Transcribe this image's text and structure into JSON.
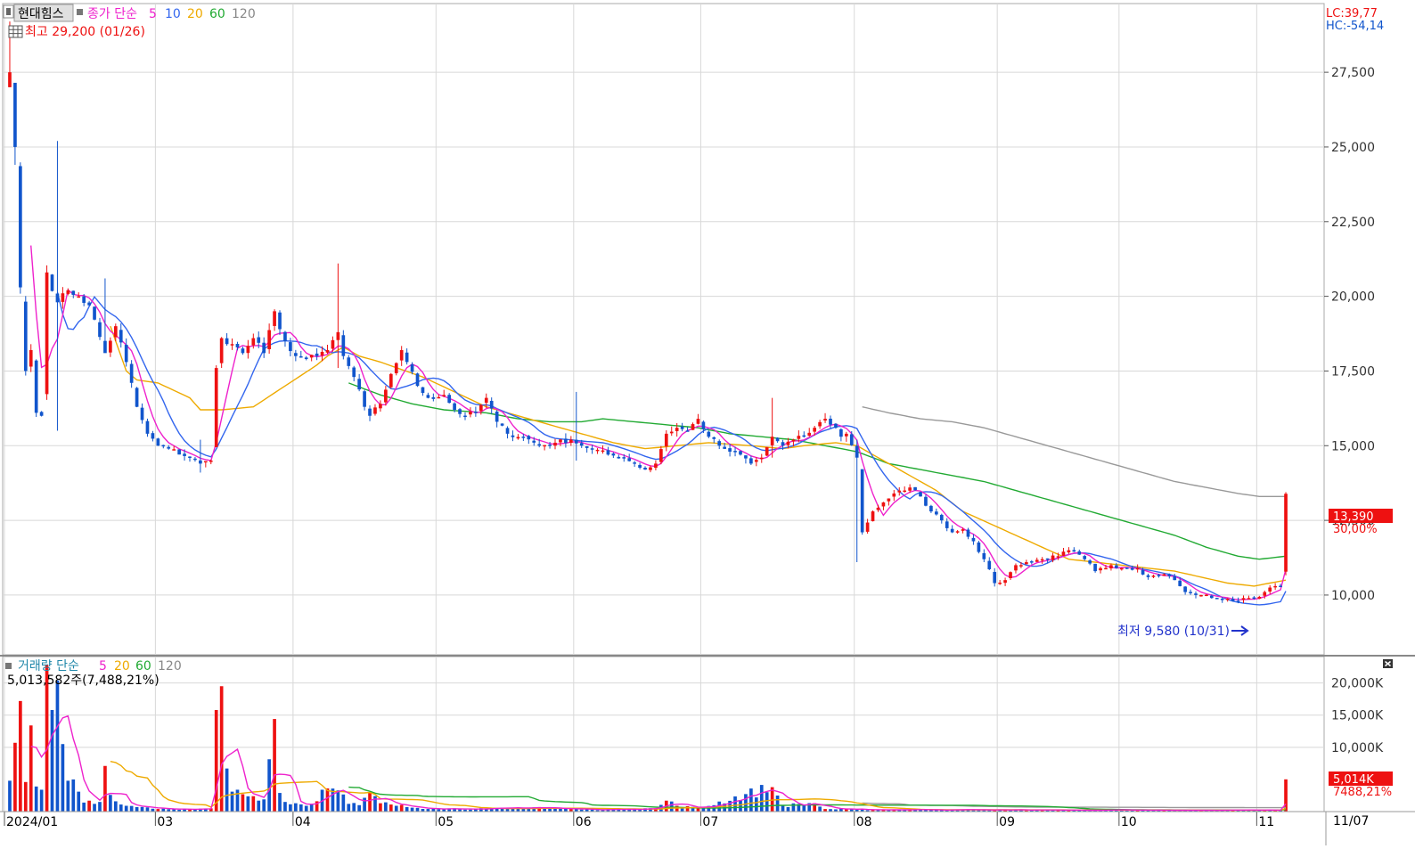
{
  "legend_price": {
    "symbol": "현대힘스",
    "ma_label": "종가 단순",
    "ma_periods": [
      "5",
      "10",
      "20",
      "60",
      "120"
    ],
    "high_label": "최고 29,200 (01/26)",
    "low_label": "최저 9,580 (10/31)"
  },
  "legend_volume": {
    "label": "거래량 단순",
    "ma_periods": [
      "5",
      "20",
      "60",
      "120"
    ],
    "current": "5,013,582주(7,488,21%)"
  },
  "indicators": {
    "lc": "LC:39,77",
    "hc": "HC:-54,14"
  },
  "price_tag": {
    "value": "13,390",
    "change": "30,00%"
  },
  "volume_tag": {
    "value": "5,014K",
    "change": "7488,21%"
  },
  "colors": {
    "up": "#ee1111",
    "down": "#1155cc",
    "ma5": "#ee22cc",
    "ma10": "#3366ee",
    "ma20": "#eeaa00",
    "ma60": "#22aa33",
    "ma120": "#999999",
    "grid": "#d8d8d8",
    "symbol_box": "#e0e0e0"
  },
  "chart_data": [
    {
      "type": "candlestick",
      "name": "price",
      "x_ticks": [
        {
          "i": 0,
          "label": "2024/01"
        },
        {
          "i": 28,
          "label": "03"
        },
        {
          "i": 54,
          "label": "04"
        },
        {
          "i": 81,
          "label": "05"
        },
        {
          "i": 107,
          "label": "06"
        },
        {
          "i": 131,
          "label": "07"
        },
        {
          "i": 160,
          "label": "08"
        },
        {
          "i": 187,
          "label": "09"
        },
        {
          "i": 210,
          "label": "10"
        },
        {
          "i": 236,
          "label": "11"
        }
      ],
      "x_end_label": "11/07",
      "n": 242,
      "ylim": [
        8000,
        29800
      ],
      "y_ticks": [
        10000,
        12500,
        15000,
        17500,
        20000,
        22500,
        25000,
        27500
      ],
      "y_tick_labels": [
        "10,000",
        "12,500",
        "15,000",
        "17,500",
        "20,000",
        "22,500",
        "25,000",
        "27,500"
      ],
      "keypoints": [
        [
          0,
          27500
        ],
        [
          1,
          25000
        ],
        [
          2,
          20300
        ],
        [
          3,
          17500
        ],
        [
          4,
          18200
        ],
        [
          5,
          16100
        ],
        [
          6,
          16000
        ],
        [
          7,
          20800
        ],
        [
          9,
          19800
        ],
        [
          11,
          20200
        ],
        [
          13,
          20000
        ],
        [
          15,
          19700
        ],
        [
          18,
          18100
        ],
        [
          20,
          19000
        ],
        [
          22,
          17800
        ],
        [
          24,
          16300
        ],
        [
          26,
          15400
        ],
        [
          28,
          15000
        ],
        [
          30,
          14900
        ],
        [
          34,
          14600
        ],
        [
          36,
          14400
        ],
        [
          38,
          14500
        ],
        [
          39,
          17600
        ],
        [
          40,
          18600
        ],
        [
          42,
          18400
        ],
        [
          44,
          18100
        ],
        [
          46,
          18600
        ],
        [
          48,
          18100
        ],
        [
          50,
          19500
        ],
        [
          51,
          18900
        ],
        [
          52,
          18500
        ],
        [
          54,
          18000
        ],
        [
          56,
          17900
        ],
        [
          58,
          18000
        ],
        [
          60,
          18200
        ],
        [
          62,
          18800
        ],
        [
          63,
          18000
        ],
        [
          65,
          17300
        ],
        [
          67,
          16300
        ],
        [
          68,
          16000
        ],
        [
          70,
          16400
        ],
        [
          72,
          17400
        ],
        [
          74,
          18200
        ],
        [
          75,
          17800
        ],
        [
          77,
          17000
        ],
        [
          79,
          16600
        ],
        [
          82,
          16700
        ],
        [
          84,
          16200
        ],
        [
          86,
          16000
        ],
        [
          88,
          16100
        ],
        [
          90,
          16600
        ],
        [
          92,
          15800
        ],
        [
          94,
          15400
        ],
        [
          97,
          15300
        ],
        [
          100,
          15000
        ],
        [
          103,
          15100
        ],
        [
          106,
          15200
        ],
        [
          108,
          15000
        ],
        [
          110,
          14900
        ],
        [
          113,
          14700
        ],
        [
          116,
          14600
        ],
        [
          118,
          14400
        ],
        [
          120,
          14200
        ],
        [
          122,
          14400
        ],
        [
          124,
          15400
        ],
        [
          126,
          15600
        ],
        [
          128,
          15500
        ],
        [
          130,
          15900
        ],
        [
          132,
          15300
        ],
        [
          134,
          15000
        ],
        [
          136,
          14800
        ],
        [
          138,
          14700
        ],
        [
          140,
          14400
        ],
        [
          142,
          14600
        ],
        [
          144,
          15300
        ],
        [
          146,
          15000
        ],
        [
          148,
          15200
        ],
        [
          150,
          15300
        ],
        [
          152,
          15600
        ],
        [
          154,
          15900
        ],
        [
          156,
          15600
        ],
        [
          157,
          15300
        ],
        [
          158,
          15400
        ],
        [
          160,
          14600
        ],
        [
          161,
          12100
        ],
        [
          163,
          12800
        ],
        [
          165,
          13100
        ],
        [
          167,
          13400
        ],
        [
          169,
          13500
        ],
        [
          170,
          13600
        ],
        [
          172,
          13300
        ],
        [
          174,
          12800
        ],
        [
          176,
          12500
        ],
        [
          178,
          12100
        ],
        [
          180,
          12200
        ],
        [
          182,
          11800
        ],
        [
          184,
          11200
        ],
        [
          186,
          10400
        ],
        [
          188,
          10500
        ],
        [
          190,
          11000
        ],
        [
          192,
          11100
        ],
        [
          195,
          11200
        ],
        [
          198,
          11300
        ],
        [
          200,
          11500
        ],
        [
          203,
          11200
        ],
        [
          205,
          10800
        ],
        [
          208,
          11000
        ],
        [
          211,
          10900
        ],
        [
          213,
          10900
        ],
        [
          215,
          10600
        ],
        [
          218,
          10700
        ],
        [
          220,
          10500
        ],
        [
          222,
          10100
        ],
        [
          225,
          10000
        ],
        [
          228,
          9900
        ],
        [
          231,
          9800
        ],
        [
          233,
          9900
        ],
        [
          235,
          9900
        ],
        [
          237,
          10100
        ],
        [
          239,
          10300
        ],
        [
          240,
          10300
        ],
        [
          241,
          13390
        ]
      ],
      "wicks": {
        "0": [
          27000,
          29200
        ],
        "1": [
          24400,
          25050
        ],
        "9": [
          15500,
          25200
        ],
        "18": [
          18400,
          20600
        ],
        "36": [
          14100,
          15200
        ],
        "62": [
          17600,
          21100
        ],
        "107": [
          14500,
          16800
        ],
        "144": [
          14600,
          16600
        ],
        "160": [
          11100,
          15200
        ]
      },
      "ma_offsets": {
        "ma10": [
          [
            0,
            0
          ],
          [
            20,
            0
          ],
          [
            50,
            -60
          ],
          [
            100,
            70
          ],
          [
            140,
            100
          ],
          [
            170,
            160
          ],
          [
            200,
            120
          ],
          [
            241,
            -250
          ]
        ]
      },
      "ma_start": {
        "ma5": 4,
        "ma10": 9,
        "ma20": 19,
        "ma60": 64,
        "ma120": 161
      },
      "ma20_keypoints": [
        [
          19,
          19000
        ],
        [
          22,
          17500
        ],
        [
          24,
          17200
        ],
        [
          28,
          17100
        ],
        [
          34,
          16600
        ],
        [
          36,
          16200
        ],
        [
          40,
          16200
        ],
        [
          46,
          16300
        ],
        [
          52,
          17000
        ],
        [
          58,
          17700
        ],
        [
          60,
          18000
        ],
        [
          63,
          18300
        ],
        [
          66,
          18000
        ],
        [
          70,
          17800
        ],
        [
          78,
          17300
        ],
        [
          84,
          16800
        ],
        [
          90,
          16300
        ],
        [
          96,
          16000
        ],
        [
          102,
          15700
        ],
        [
          108,
          15400
        ],
        [
          114,
          15100
        ],
        [
          120,
          14900
        ],
        [
          126,
          15000
        ],
        [
          132,
          15100
        ],
        [
          140,
          15000
        ],
        [
          146,
          14900
        ],
        [
          150,
          15000
        ],
        [
          156,
          15100
        ],
        [
          160,
          15000
        ],
        [
          165,
          14500
        ],
        [
          170,
          14000
        ],
        [
          175,
          13500
        ],
        [
          180,
          12800
        ],
        [
          185,
          12400
        ],
        [
          190,
          12000
        ],
        [
          195,
          11600
        ],
        [
          200,
          11200
        ],
        [
          205,
          11100
        ],
        [
          210,
          11000
        ],
        [
          215,
          10900
        ],
        [
          220,
          10800
        ],
        [
          225,
          10600
        ],
        [
          230,
          10400
        ],
        [
          235,
          10300
        ],
        [
          241,
          10500
        ]
      ],
      "ma60_keypoints": [
        [
          64,
          17100
        ],
        [
          70,
          16700
        ],
        [
          76,
          16400
        ],
        [
          82,
          16200
        ],
        [
          90,
          16100
        ],
        [
          96,
          15900
        ],
        [
          102,
          15800
        ],
        [
          108,
          15800
        ],
        [
          112,
          15900
        ],
        [
          118,
          15800
        ],
        [
          124,
          15700
        ],
        [
          130,
          15600
        ],
        [
          136,
          15400
        ],
        [
          142,
          15300
        ],
        [
          148,
          15200
        ],
        [
          154,
          15000
        ],
        [
          160,
          14800
        ],
        [
          166,
          14400
        ],
        [
          172,
          14200
        ],
        [
          178,
          14000
        ],
        [
          184,
          13800
        ],
        [
          190,
          13500
        ],
        [
          196,
          13200
        ],
        [
          202,
          12900
        ],
        [
          208,
          12600
        ],
        [
          214,
          12300
        ],
        [
          220,
          12000
        ],
        [
          226,
          11600
        ],
        [
          232,
          11300
        ],
        [
          236,
          11200
        ],
        [
          241,
          11300
        ]
      ],
      "ma120_keypoints": [
        [
          161,
          16300
        ],
        [
          166,
          16100
        ],
        [
          172,
          15900
        ],
        [
          178,
          15800
        ],
        [
          184,
          15600
        ],
        [
          190,
          15300
        ],
        [
          196,
          15000
        ],
        [
          202,
          14700
        ],
        [
          208,
          14400
        ],
        [
          214,
          14100
        ],
        [
          220,
          13800
        ],
        [
          226,
          13600
        ],
        [
          232,
          13400
        ],
        [
          236,
          13300
        ],
        [
          241,
          13300
        ]
      ]
    },
    {
      "type": "bar",
      "name": "volume",
      "ylim": [
        0,
        23000
      ],
      "y_ticks": [
        10000,
        15000,
        20000
      ],
      "y_tick_labels": [
        "10,000K",
        "15,000K",
        "20,000K"
      ],
      "unit": "K",
      "keypoints": [
        [
          0,
          4800
        ],
        [
          1,
          10700
        ],
        [
          2,
          17200
        ],
        [
          3,
          4600
        ],
        [
          4,
          13400
        ],
        [
          5,
          3900
        ],
        [
          6,
          3400
        ],
        [
          7,
          22800
        ],
        [
          8,
          15800
        ],
        [
          9,
          20400
        ],
        [
          10,
          10500
        ],
        [
          11,
          4800
        ],
        [
          12,
          5000
        ],
        [
          13,
          3100
        ],
        [
          14,
          1400
        ],
        [
          15,
          1700
        ],
        [
          16,
          1200
        ],
        [
          17,
          1500
        ],
        [
          18,
          7100
        ],
        [
          19,
          2600
        ],
        [
          20,
          1600
        ],
        [
          21,
          1100
        ],
        [
          22,
          900
        ],
        [
          24,
          700
        ],
        [
          28,
          400
        ],
        [
          34,
          400
        ],
        [
          38,
          500
        ],
        [
          39,
          15800
        ],
        [
          40,
          19500
        ],
        [
          41,
          6700
        ],
        [
          42,
          3100
        ],
        [
          43,
          3400
        ],
        [
          44,
          2700
        ],
        [
          46,
          2400
        ],
        [
          48,
          1900
        ],
        [
          50,
          14400
        ],
        [
          51,
          2900
        ],
        [
          52,
          1500
        ],
        [
          54,
          1300
        ],
        [
          56,
          900
        ],
        [
          60,
          3600
        ],
        [
          62,
          3300
        ],
        [
          64,
          1200
        ],
        [
          66,
          1000
        ],
        [
          68,
          2900
        ],
        [
          70,
          1300
        ],
        [
          72,
          1100
        ],
        [
          75,
          700
        ],
        [
          80,
          500
        ],
        [
          90,
          400
        ],
        [
          100,
          700
        ],
        [
          102,
          500
        ],
        [
          110,
          300
        ],
        [
          122,
          500
        ],
        [
          124,
          1700
        ],
        [
          126,
          900
        ],
        [
          130,
          500
        ],
        [
          144,
          3800
        ],
        [
          146,
          900
        ],
        [
          152,
          1300
        ],
        [
          154,
          400
        ],
        [
          160,
          300
        ],
        [
          170,
          300
        ],
        [
          190,
          250
        ],
        [
          220,
          200
        ],
        [
          240,
          250
        ],
        [
          241,
          5014
        ]
      ],
      "up_days": [
        1,
        2,
        3,
        4,
        7,
        15,
        18,
        28,
        34,
        38,
        39,
        40,
        44,
        46,
        50,
        58,
        60,
        68,
        70,
        72,
        74,
        100,
        106,
        122,
        124,
        126,
        128,
        130,
        144,
        152,
        154,
        158,
        163,
        165,
        167,
        170,
        186,
        188,
        192,
        195,
        198,
        200,
        213,
        218,
        225,
        231,
        237,
        239,
        241
      ]
    }
  ]
}
